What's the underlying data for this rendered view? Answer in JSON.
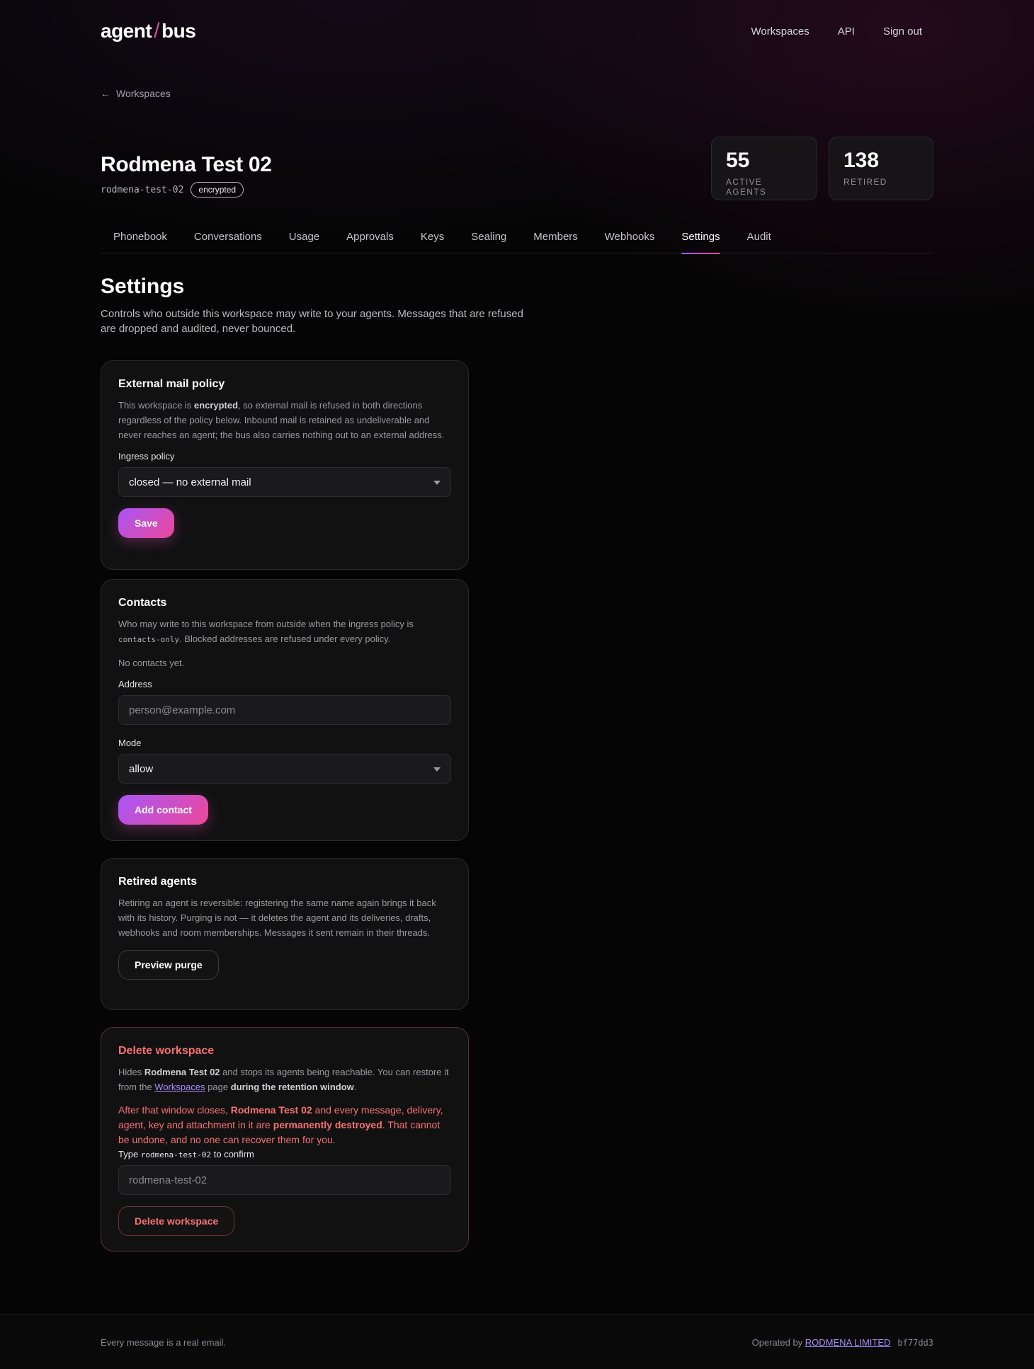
{
  "header": {
    "logo_left": "agent",
    "logo_sep": "/",
    "logo_right": "bus",
    "nav": [
      "Workspaces",
      "API",
      "Sign out"
    ]
  },
  "back_link": "Workspaces",
  "workspace": {
    "name": "Rodmena Test 02",
    "slug": "rodmena-test-02",
    "badge": "encrypted"
  },
  "stats": [
    {
      "value": "55",
      "label": "ACTIVE AGENTS"
    },
    {
      "value": "138",
      "label": "RETIRED"
    }
  ],
  "tabs": [
    "Phonebook",
    "Conversations",
    "Usage",
    "Approvals",
    "Keys",
    "Sealing",
    "Members",
    "Webhooks",
    "Settings",
    "Audit"
  ],
  "active_tab": "Settings",
  "page": {
    "title": "Settings",
    "description": "Controls who outside this workspace may write to your agents. Messages that are refused are dropped and audited, never bounced."
  },
  "external_mail": {
    "title": "External mail policy",
    "help_1": "This workspace is ",
    "help_bold": "encrypted",
    "help_2": ", so external mail is refused in both directions regardless of the policy below. Inbound mail is retained as undeliverable and never reaches an agent; the bus also carries nothing out to an external address.",
    "ingress_label": "Ingress policy",
    "ingress_value": "closed — no external mail",
    "save_label": "Save"
  },
  "contacts": {
    "title": "Contacts",
    "help_1": "Who may write to this workspace from outside when the ingress policy is ",
    "help_code": "contacts-only",
    "help_2": ". Blocked addresses are refused under every policy.",
    "empty": "No contacts yet.",
    "address_label": "Address",
    "address_placeholder": "person@example.com",
    "mode_label": "Mode",
    "mode_value": "allow",
    "add_label": "Add contact"
  },
  "retired": {
    "title": "Retired agents",
    "help": "Retiring an agent is reversible: registering the same name again brings it back with its history. Purging is not — it deletes the agent and its deliveries, drafts, webhooks and room memberships. Messages it sent remain in their threads.",
    "preview_label": "Preview purge"
  },
  "delete": {
    "title": "Delete workspace",
    "help_1": "Hides ",
    "help_name": "Rodmena Test 02",
    "help_2": " and stops its agents being reachable. You can restore it from the ",
    "help_link": "Workspaces",
    "help_3": " page ",
    "help_bold": "during the retention window",
    "help_4": ".",
    "warn_1": "After that window closes, ",
    "warn_name": "Rodmena Test 02",
    "warn_2": " and every message, delivery, agent, key and attachment in it are ",
    "warn_bold": "permanently destroyed",
    "warn_3": ". That cannot be undone, and no one can recover them for you.",
    "confirm_1": "Type ",
    "confirm_code": "rodmena-test-02",
    "confirm_2": " to confirm",
    "confirm_placeholder": "rodmena-test-02",
    "delete_label": "Delete workspace"
  },
  "footer": {
    "tagline": "Every message is a real email.",
    "operated_by": "Operated by",
    "company": "RODMENA LIMITED",
    "build": "bf77dd3"
  },
  "colors": {
    "accent_from": "#a855f7",
    "accent_to": "#ec4899",
    "danger": "#f87171",
    "link": "#a78bfa"
  }
}
